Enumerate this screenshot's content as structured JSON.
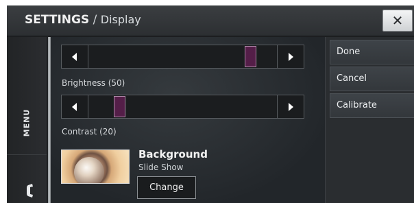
{
  "header": {
    "title_main": "SETTINGS",
    "title_sep": " / ",
    "title_sub": "Display",
    "close_glyph": "✕"
  },
  "leftnav": {
    "menu_label": "MENU",
    "phone_icon": "phone-icon"
  },
  "brightness": {
    "label": "Brightness (50)",
    "value": 50,
    "left_icon": "arrow-left-icon",
    "right_icon": "arrow-right-icon"
  },
  "contrast": {
    "label": "Contrast (20)",
    "value": 20,
    "left_icon": "arrow-left-icon",
    "right_icon": "arrow-right-icon"
  },
  "background": {
    "title": "Background",
    "subtitle": "Slide Show",
    "change_label": "Change"
  },
  "actions": {
    "done": "Done",
    "cancel": "Cancel",
    "calibrate": "Calibrate"
  },
  "colors": {
    "thumb_fill": "#541e48",
    "panel_bg": "#1f2123"
  }
}
